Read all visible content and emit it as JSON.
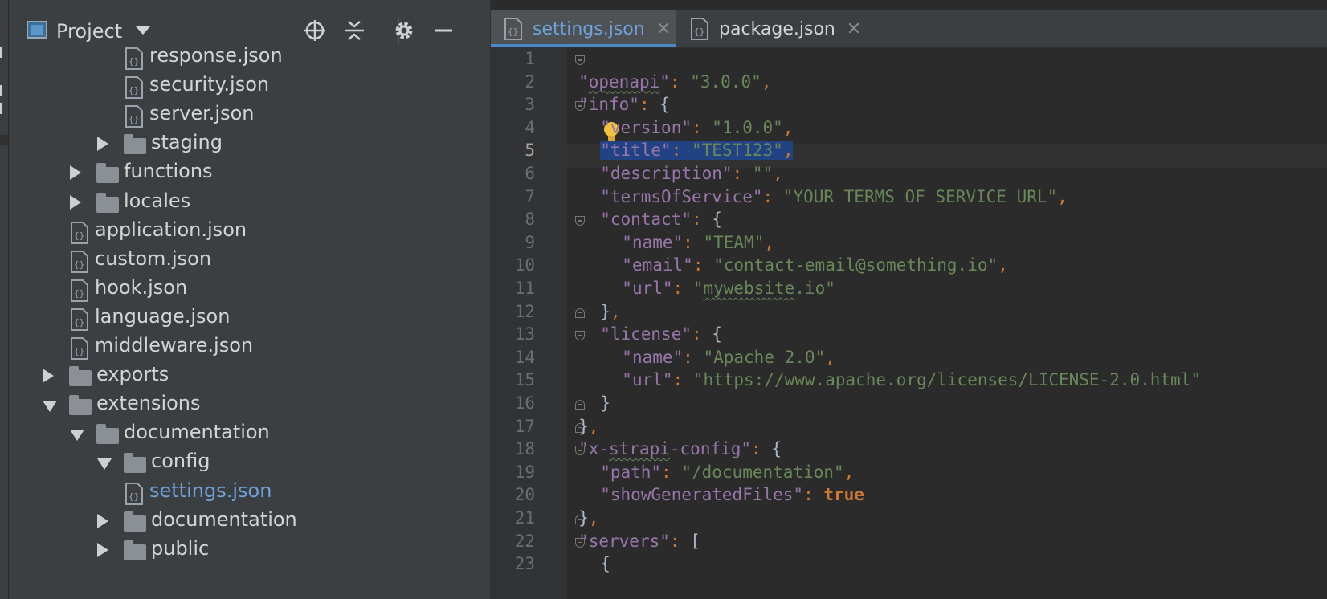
{
  "panel": {
    "title": "Project",
    "tools": [
      "locate-icon",
      "collapse-all-icon",
      "gear-icon",
      "minimize-icon"
    ]
  },
  "tree": [
    {
      "label": "response.json",
      "type": "file",
      "depth": 5
    },
    {
      "label": "security.json",
      "type": "file",
      "depth": 5
    },
    {
      "label": "server.json",
      "type": "file",
      "depth": 5
    },
    {
      "label": "staging",
      "type": "folder",
      "state": "collapsed",
      "depth": 4
    },
    {
      "label": "functions",
      "type": "folder",
      "state": "collapsed",
      "depth": 3
    },
    {
      "label": "locales",
      "type": "folder",
      "state": "collapsed",
      "depth": 3
    },
    {
      "label": "application.json",
      "type": "file",
      "depth": 3
    },
    {
      "label": "custom.json",
      "type": "file",
      "depth": 3
    },
    {
      "label": "hook.json",
      "type": "file",
      "depth": 3
    },
    {
      "label": "language.json",
      "type": "file",
      "depth": 3
    },
    {
      "label": "middleware.json",
      "type": "file",
      "depth": 3
    },
    {
      "label": "exports",
      "type": "folder",
      "state": "collapsed",
      "depth": 2
    },
    {
      "label": "extensions",
      "type": "folder",
      "state": "expanded",
      "depth": 2
    },
    {
      "label": "documentation",
      "type": "folder",
      "state": "expanded",
      "depth": 3
    },
    {
      "label": "config",
      "type": "folder",
      "state": "expanded",
      "depth": 4
    },
    {
      "label": "settings.json",
      "type": "file",
      "depth": 5,
      "selected": true
    },
    {
      "label": "documentation",
      "type": "folder",
      "state": "collapsed",
      "depth": 4
    },
    {
      "label": "public",
      "type": "folder",
      "state": "collapsed",
      "depth": 4
    }
  ],
  "tabs": [
    {
      "label": "settings.json",
      "active": true
    },
    {
      "label": "package.json",
      "active": false
    }
  ],
  "editor": {
    "current_line": 5,
    "lines": [
      "{",
      "  \"openapi\": \"3.0.0\",",
      "  \"info\": {",
      "    \"version\": \"1.0.0\",",
      "    \"title\": \"TEST123\",",
      "    \"description\": \"\",",
      "    \"termsOfService\": \"YOUR_TERMS_OF_SERVICE_URL\",",
      "    \"contact\": {",
      "      \"name\": \"TEAM\",",
      "      \"email\": \"contact-email@something.io\",",
      "      \"url\": \"mywebsite.io\"",
      "    },",
      "    \"license\": {",
      "      \"name\": \"Apache 2.0\",",
      "      \"url\": \"https://www.apache.org/licenses/LICENSE-2.0.html\"",
      "    }",
      "  },",
      "  \"x-strapi-config\": {",
      "    \"path\": \"/documentation\",",
      "    \"showGeneratedFiles\": true",
      "  },",
      "  \"servers\": [",
      "    {"
    ]
  },
  "colors": {
    "key": "#9876aa",
    "string": "#6a8759",
    "keyword": "#cc7832",
    "selection": "#214283",
    "accent": "#4a88c7"
  }
}
